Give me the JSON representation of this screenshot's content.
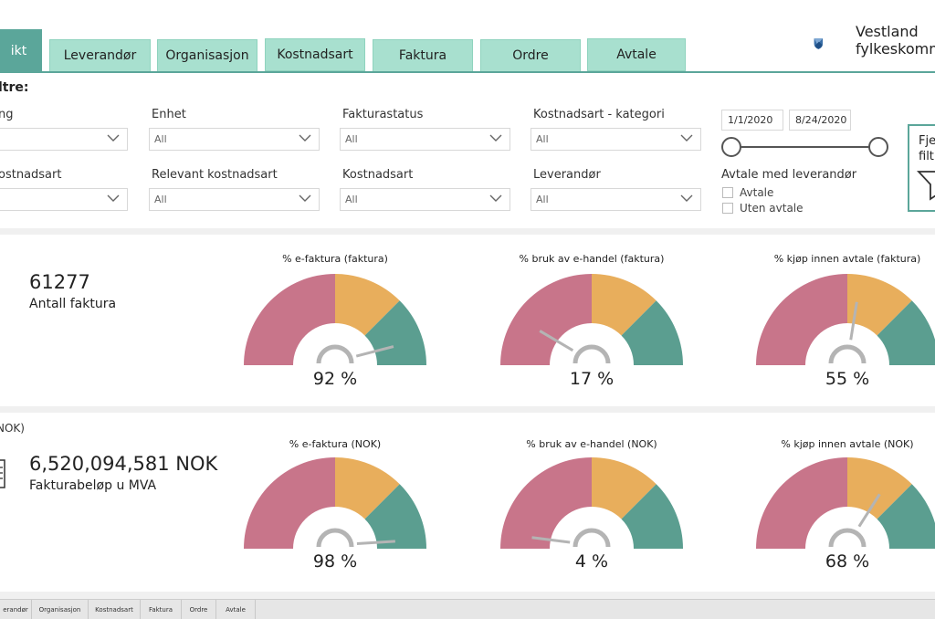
{
  "tabs": [
    {
      "label": "ikt",
      "active": true
    },
    {
      "label": "Leverandør"
    },
    {
      "label": "Organisasjon"
    },
    {
      "label": "Kostnadsart"
    },
    {
      "label": "Faktura"
    },
    {
      "label": "Ordre"
    },
    {
      "label": "Avtale"
    }
  ],
  "logo": {
    "line1": "Vestland",
    "line2": "fylkeskomm"
  },
  "filters": {
    "title": "ltre:",
    "row1": [
      {
        "label": "ng",
        "value": ""
      },
      {
        "label": "Enhet",
        "value": "All"
      },
      {
        "label": "Fakturastatus",
        "value": "All"
      },
      {
        "label": "Kostnadsart - kategori",
        "value": "All"
      }
    ],
    "row2": [
      {
        "label": "ostnadsart",
        "value": ""
      },
      {
        "label": "Relevant kostnadsart",
        "value": "All"
      },
      {
        "label": "Kostnadsart",
        "value": "All"
      },
      {
        "label": "Leverandør",
        "value": "All"
      }
    ],
    "date_start": "1/1/2020",
    "date_end": "8/24/2020",
    "avtale_title": "Avtale med leverandør",
    "avtale_options": [
      "Avtale",
      "Uten avtale"
    ],
    "reset_line1": "Fje",
    "reset_line2": "filtr"
  },
  "panel1": {
    "kpi_value": "61277",
    "kpi_label": "Antall faktura",
    "gauges": [
      {
        "title": "% e-faktura (faktura)",
        "value_text": "92 %",
        "value": 92
      },
      {
        "title": "% bruk av e-handel (faktura)",
        "value_text": "17 %",
        "value": 17
      },
      {
        "title": "% kjøp innen avtale (faktura)",
        "value_text": "55 %",
        "value": 55
      }
    ]
  },
  "panel2": {
    "section_label": "NOK)",
    "kpi_value": "6,520,094,581 NOK",
    "kpi_label": "Fakturabeløp u MVA",
    "gauges": [
      {
        "title": "% e-faktura (NOK)",
        "value_text": "98 %",
        "value": 98
      },
      {
        "title": "% bruk av e-handel (NOK)",
        "value_text": "4 %",
        "value": 4
      },
      {
        "title": "% kjøp innen avtale (NOK)",
        "value_text": "68 %",
        "value": 68
      }
    ]
  },
  "gauge_colors": {
    "red": "#c8758a",
    "orange": "#e8ae5c",
    "green": "#5b9e90",
    "needle": "#b4b4b4"
  },
  "gauge_bands": [
    {
      "from": 0,
      "to": 50,
      "color": "red"
    },
    {
      "from": 50,
      "to": 75,
      "color": "orange"
    },
    {
      "from": 75,
      "to": 100,
      "color": "green"
    }
  ],
  "bottom_tabs": [
    "erandør",
    "Organisasjon",
    "Kostnadsart",
    "Faktura",
    "Ordre",
    "Avtale"
  ]
}
